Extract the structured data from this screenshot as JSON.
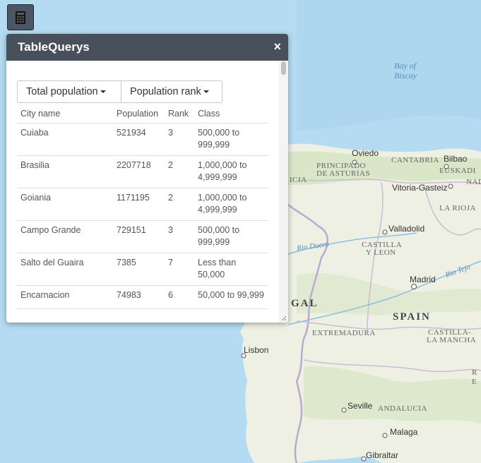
{
  "panel": {
    "title": "TableQuerys",
    "close_glyph": "×",
    "dropdowns": [
      {
        "label": "Total population"
      },
      {
        "label": "Population rank"
      }
    ],
    "columns": [
      "City name",
      "Population",
      "Rank",
      "Class"
    ],
    "rows": [
      {
        "city": "Cuiaba",
        "population": "521934",
        "rank": "3",
        "class": "500,000 to 999,999"
      },
      {
        "city": "Brasilia",
        "population": "2207718",
        "rank": "2",
        "class": "1,000,000 to 4,999,999"
      },
      {
        "city": "Goiania",
        "population": "1171195",
        "rank": "2",
        "class": "1,000,000 to 4,999,999"
      },
      {
        "city": "Campo Grande",
        "population": "729151",
        "rank": "3",
        "class": "500,000 to 999,999"
      },
      {
        "city": "Salto del Guaira",
        "population": "7385",
        "rank": "7",
        "class": "Less than 50,000"
      },
      {
        "city": "Encarnacion",
        "population": "74983",
        "rank": "6",
        "class": "50,000 to 99,999"
      }
    ]
  },
  "toolbar": {
    "icon": "table-icon"
  },
  "map": {
    "water": {
      "bay": "Bay of Biscay",
      "rio_duero": "Rio Duero",
      "rio_tejo": "Rio Tejo"
    },
    "regions": {
      "asturias_1": "PRINCIPADO",
      "asturias_2": "DE ASTURIAS",
      "cantabria": "CANTABRIA",
      "euskadi": "EUSKADI",
      "la_rioja": "LA RIOJA",
      "castilla_leon_1": "CASTILLA",
      "castilla_leon_2": "Y LEON",
      "extremadura": "EXTREMADURA",
      "castilla_mancha_1": "CASTILLA-",
      "castilla_mancha_2": "LA MANCHA",
      "andalucia": "ANDALUCIA",
      "galicia_frag": "ICIA",
      "nad_frag": "NAD",
      "portugal_frag": "GAL",
      "r_frag": "R",
      "e_frag": "E"
    },
    "country": "SPAIN",
    "cities": {
      "oviedo": "Oviedo",
      "bilbao": "Bilbao",
      "vitoria": "Vitoria-Gasteiz",
      "valladolid": "Valladolid",
      "madrid": "Madrid",
      "lisbon": "Lisbon",
      "seville": "Seville",
      "malaga": "Malaga",
      "gibraltar": "Gibraltar"
    },
    "colors": {
      "sea": "#b5dcf2",
      "land": "#eef0e6",
      "forest": "#d4e3bd",
      "border": "#b8a9c9"
    }
  }
}
